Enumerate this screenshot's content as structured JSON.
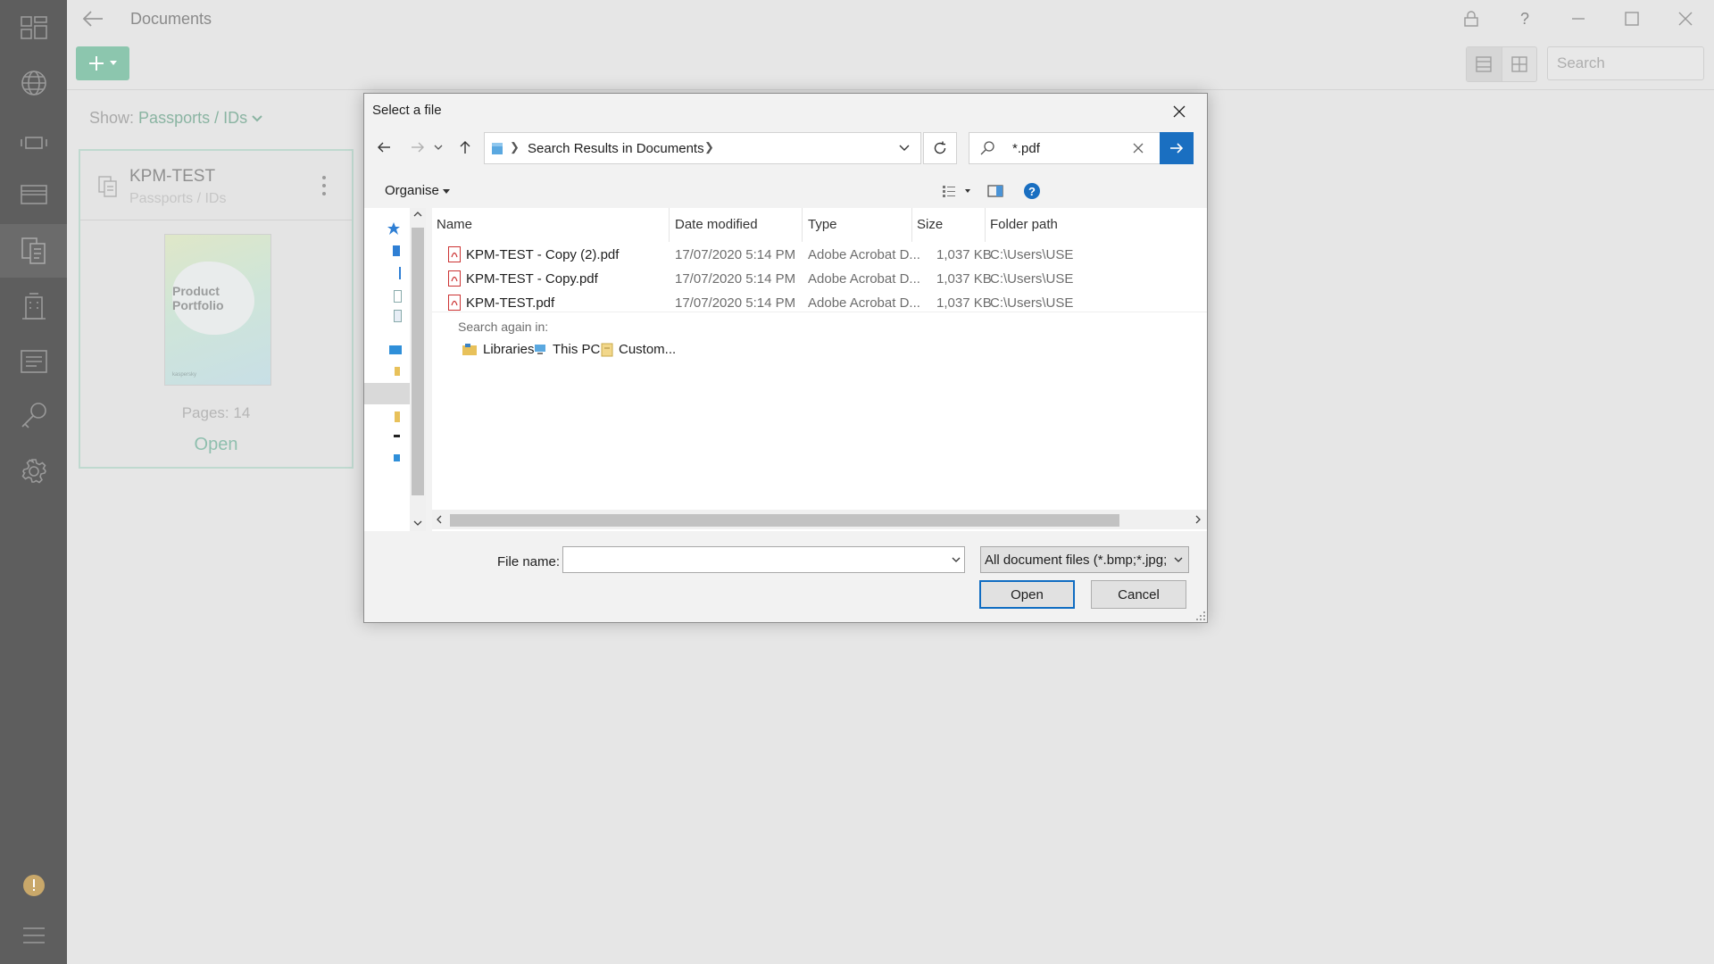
{
  "app": {
    "title": "Documents",
    "search_placeholder": "Search",
    "show_label": "Show:",
    "show_value": "Passports / IDs",
    "card": {
      "title": "KPM-TEST",
      "subtitle": "Passports / IDs",
      "thumb_title": "Product Portfolio",
      "thumb_brand": "kaspersky",
      "pages": "Pages: 14",
      "open": "Open"
    }
  },
  "sidebar": {
    "icons": [
      "dashboard-icon",
      "globe-icon",
      "wallet-icon",
      "card-icon",
      "documents-icon",
      "building-icon",
      "note-icon",
      "key-icon",
      "settings-icon",
      "alert-icon",
      "menu-icon"
    ],
    "active": "documents-icon",
    "accent": "#5e5e5e"
  },
  "dialog": {
    "title": "Select a file",
    "address": "Search Results in Documents",
    "search_value": "*.pdf",
    "organise": "Organise",
    "columns": [
      "Name",
      "Date modified",
      "Type",
      "Size",
      "Folder path"
    ],
    "files": [
      {
        "name": "KPM-TEST - Copy (2).pdf",
        "date": "17/07/2020 5:14 PM",
        "type": "Adobe Acrobat D...",
        "size": "1,037 KB",
        "path": "C:\\Users\\USE"
      },
      {
        "name": "KPM-TEST - Copy.pdf",
        "date": "17/07/2020 5:14 PM",
        "type": "Adobe Acrobat D...",
        "size": "1,037 KB",
        "path": "C:\\Users\\USE"
      },
      {
        "name": "KPM-TEST.pdf",
        "date": "17/07/2020 5:14 PM",
        "type": "Adobe Acrobat D...",
        "size": "1,037 KB",
        "path": "C:\\Users\\USE"
      }
    ],
    "search_again": "Search again in:",
    "locations": [
      "Libraries",
      "This PC",
      "Custom..."
    ],
    "file_name_label": "File name:",
    "file_name_value": "",
    "file_type": "All document files (*.bmp;*.jpg;",
    "open_button": "Open",
    "cancel_button": "Cancel",
    "accent": "#1a6fc1"
  }
}
